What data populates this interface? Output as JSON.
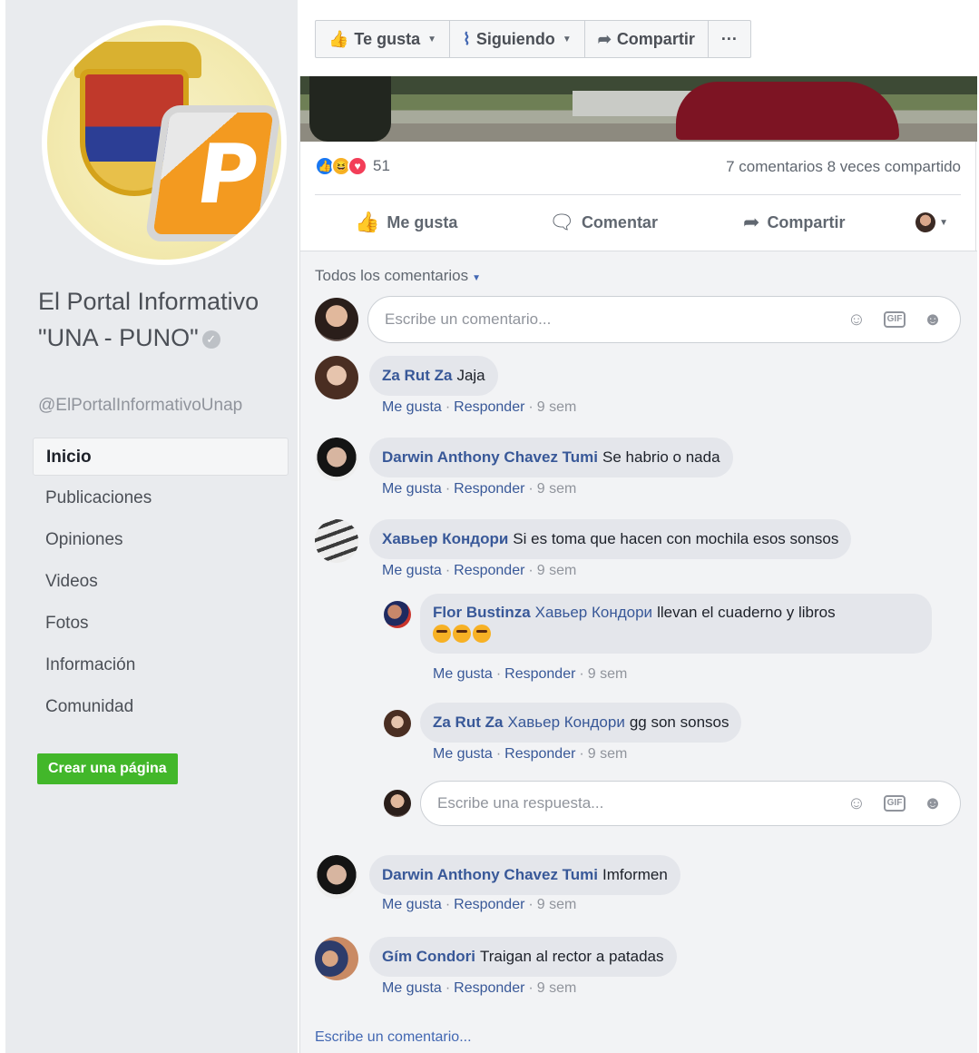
{
  "sidebar": {
    "page_name": "El Portal Informativo \"UNA - PUNO\"",
    "handle": "@ElPortalInformativoUnap",
    "nav": [
      {
        "label": "Inicio"
      },
      {
        "label": "Publicaciones"
      },
      {
        "label": "Opiniones"
      },
      {
        "label": "Videos"
      },
      {
        "label": "Fotos"
      },
      {
        "label": "Información"
      },
      {
        "label": "Comunidad"
      }
    ],
    "create_page": "Crear una página"
  },
  "topbar": {
    "like": "Te gusta",
    "following": "Siguiendo",
    "share": "Compartir",
    "more": "···"
  },
  "post": {
    "reaction_count": "51",
    "comments_count": "7 comentarios",
    "shares_count": "8 veces compartido",
    "action_like": "Me gusta",
    "action_comment": "Comentar",
    "action_share": "Compartir"
  },
  "comments": {
    "filter": "Todos los comentarios",
    "input_placeholder": "Escribe un comentario...",
    "reply_placeholder": "Escribe una respuesta...",
    "write_link": "Escribe un comentario...",
    "meta": {
      "like": "Me gusta",
      "reply": "Responder",
      "time": "9 sem"
    },
    "items": [
      {
        "name": "Za Rut Za",
        "text": "Jaja"
      },
      {
        "name": "Darwin Anthony Chavez Tumi",
        "text": "Se habrio o nada"
      },
      {
        "name": "Хавьер Кондори",
        "text": "Si es toma que hacen con mochila esos sonsos"
      },
      {
        "name": "Flor Bustinza",
        "tag": "Хавьер Кондори",
        "text": "llevan el cuaderno y libros"
      },
      {
        "name": "Za Rut Za",
        "tag": "Хавьер Кондори",
        "text": "gg son sonsos"
      },
      {
        "name": "Darwin Anthony Chavez Tumi",
        "text": "Imformen"
      },
      {
        "name": "Gím Condori",
        "text": "Traigan al rector a patadas"
      }
    ]
  }
}
